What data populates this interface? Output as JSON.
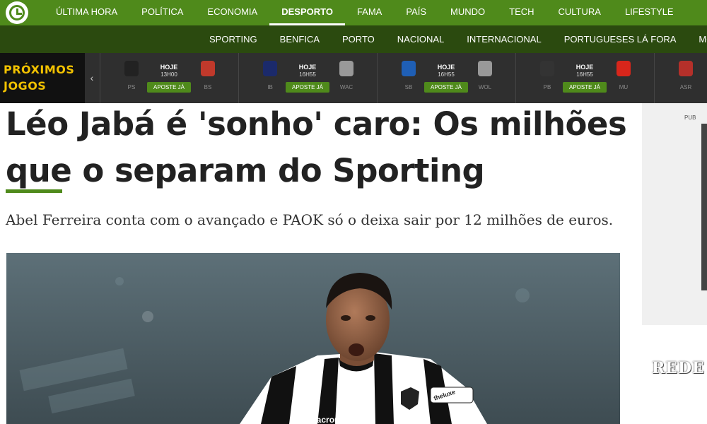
{
  "topnav": {
    "items": [
      {
        "label": "ÚLTIMA HORA"
      },
      {
        "label": "POLÍTICA"
      },
      {
        "label": "ECONOMIA"
      },
      {
        "label": "DESPORTO"
      },
      {
        "label": "FAMA"
      },
      {
        "label": "PAÍS"
      },
      {
        "label": "MUNDO"
      },
      {
        "label": "TECH"
      },
      {
        "label": "CULTURA"
      },
      {
        "label": "LIFESTYLE"
      }
    ],
    "active": "DESPORTO"
  },
  "subnav": {
    "items": [
      {
        "label": "SPORTING"
      },
      {
        "label": "BENFICA"
      },
      {
        "label": "PORTO"
      },
      {
        "label": "NACIONAL"
      },
      {
        "label": "INTERNACIONAL"
      },
      {
        "label": "PORTUGUESES LÁ FORA"
      },
      {
        "label": "MODALI"
      }
    ]
  },
  "games": {
    "title_line1": "PRÓXIMOS",
    "title_line2": "JOGOS",
    "prev_icon": "chevron-left-icon",
    "bet_label": "APOSTE JÁ",
    "matches": [
      {
        "day": "HOJE",
        "time": "13H00",
        "home": "PS",
        "away": "BS",
        "home_color": "#222222",
        "away_color": "#c0392b"
      },
      {
        "day": "HOJE",
        "time": "16H55",
        "home": "IB",
        "away": "WAC",
        "home_color": "#1b2a6b",
        "away_color": "#999999"
      },
      {
        "day": "HOJE",
        "time": "16H55",
        "home": "SB",
        "away": "WOL",
        "home_color": "#1f5fb5",
        "away_color": "#999999"
      },
      {
        "day": "HOJE",
        "time": "16H55",
        "home": "PB",
        "away": "MU",
        "home_color": "#333333",
        "away_color": "#d8261b"
      },
      {
        "day": "",
        "time": "",
        "home": "ASR",
        "away": "",
        "home_color": "#b5302a",
        "away_color": "#999999"
      }
    ]
  },
  "article": {
    "headline_line1": "Léo Jabá é 'sonho' caro: Os milhões",
    "headline_line2": "que o separam do Sporting",
    "lead": "Abel Ferreira conta com o avançado e PAOK só o deixa sair por 12 milhões de euros."
  },
  "photo": {
    "shirt_sponsor": "macron",
    "shirt_sponsor2": "theluxe"
  },
  "sidebar": {
    "pub_label": "PUB",
    "redes_label": "REDE"
  },
  "colors": {
    "brand_green": "#4f8a1b",
    "dark_green": "#2b4a0f",
    "games_bg": "#2f2f2f",
    "games_title": "#f2c200"
  }
}
